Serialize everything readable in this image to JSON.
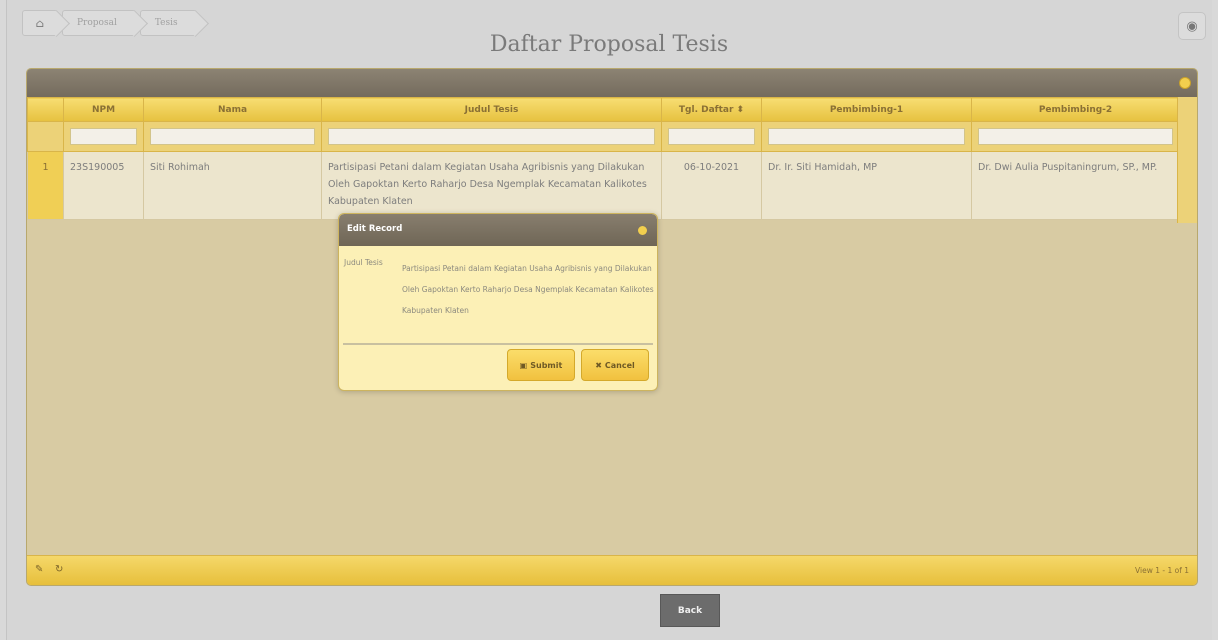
{
  "breadcrumb": {
    "home_icon": "⌂",
    "items": [
      "Proposal",
      "Tesis"
    ]
  },
  "view_icon": "◉",
  "page_title": "Daftar Proposal Tesis",
  "grid": {
    "close_icon": "●",
    "columns": [
      "",
      "NPM",
      "Nama",
      "Judul Tesis",
      "Tgl. Daftar ⬍",
      "Pembimbing-1",
      "Pembimbing-2"
    ],
    "rows": [
      {
        "index": "1",
        "npm": "23S190005",
        "nama": "Siti Rohimah",
        "judul": "Partisipasi Petani dalam Kegiatan Usaha Agribisnis yang Dilakukan Oleh Gapoktan Kerto Raharjo Desa Ngemplak Kecamatan Kalikotes Kabupaten Klaten",
        "tgl": "06-10-2021",
        "pembimbing1": "Dr. Ir. Siti Hamidah, MP",
        "pembimbing2": "Dr. Dwi Aulia Puspitaningrum, SP., MP."
      }
    ],
    "footer": {
      "edit_icon": "✎",
      "refresh_icon": "↻",
      "view_info": "View 1 - 1 of 1"
    }
  },
  "modal": {
    "title": "Edit Record",
    "field_label": "Judul Tesis",
    "field_value": "Partisipasi Petani dalam Kegiatan Usaha Agribisnis yang Dilakukan Oleh Gapoktan Kerto Raharjo Desa Ngemplak Kecamatan Kalikotes Kabupaten Klaten",
    "submit_icon": "▣",
    "submit_label": "Submit",
    "cancel_icon": "✖",
    "cancel_label": "Cancel"
  },
  "back_label": "Back"
}
